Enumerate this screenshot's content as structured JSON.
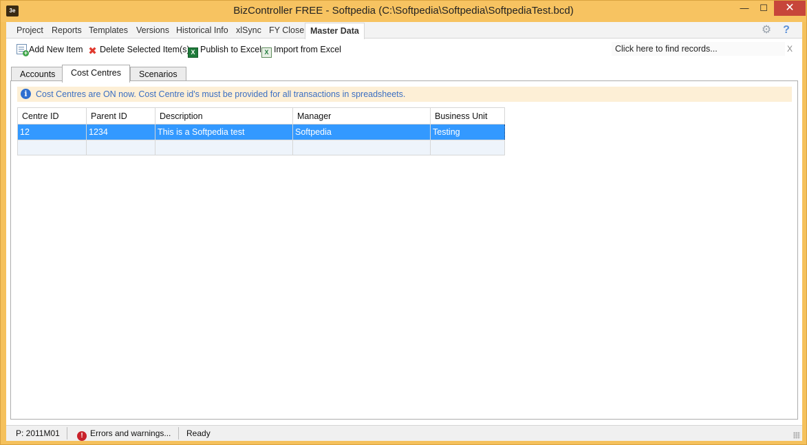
{
  "window": {
    "title": "BizController FREE - Softpedia (C:\\Softpedia\\Softpedia\\SoftpediaTest.bcd)",
    "app_icon_text": "3e",
    "minimize": "—",
    "maximize": "☐",
    "close": "✕"
  },
  "menu": {
    "items": [
      {
        "label": "Project"
      },
      {
        "label": "Reports"
      },
      {
        "label": "Templates"
      },
      {
        "label": "Versions"
      },
      {
        "label": "Historical Info"
      },
      {
        "label": "xlSync"
      },
      {
        "label": "FY Close"
      },
      {
        "label": "Master Data"
      }
    ],
    "active": "Master Data",
    "settings_icon": "gear-icon",
    "help_icon": "help-icon"
  },
  "toolbar": {
    "add_label": "Add New Item",
    "delete_label": "Delete Selected Item(s)",
    "publish_label": "Publish to Excel",
    "import_label": "Import from Excel",
    "search_text": "Click here to find records...",
    "search_clear": "X"
  },
  "tabs": {
    "items": [
      {
        "label": "Accounts"
      },
      {
        "label": "Cost Centres"
      },
      {
        "label": "Scenarios"
      }
    ],
    "active": "Cost Centres"
  },
  "info": {
    "message": "Cost Centres are ON now. Cost Centre id's must be provided for all transactions in spreadsheets."
  },
  "grid": {
    "columns": [
      "Centre ID",
      "Parent ID",
      "Description",
      "Manager",
      "Business Unit"
    ],
    "rows": [
      [
        "12",
        "1234",
        "This is a Softpedia test",
        "Softpedia",
        "Testing"
      ]
    ]
  },
  "status": {
    "period": "P: 2011M01",
    "errors": "Errors and warnings...",
    "state": "Ready"
  },
  "colors": {
    "titlebar": "#f7c361",
    "selection": "#3399ff",
    "info_background": "#fdefd6",
    "info_text": "#3a6ec2"
  }
}
